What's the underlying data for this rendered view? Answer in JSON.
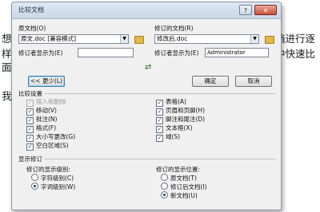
{
  "background_text": {
    "line1_left": "想要",
    "line1_right": "档进行逐",
    "line2_left": "样太",
    "line2_right": "中快速比",
    "line3_left": "面来",
    "line4_left": "我们"
  },
  "dialog": {
    "title": "比较文档",
    "help_button": "?",
    "close_button": "✕",
    "original_label": "原文档(O)",
    "original_value": "原文.doc [兼容模式]",
    "revised_label": "修订的文档(R)",
    "revised_value": "修改后.doc",
    "orig_author_label": "修订者显示为(E)",
    "orig_author_value": "",
    "rev_author_label": "修订者显示为(E)",
    "rev_author_value": "Administrator",
    "swap_icon": "⇄",
    "less_button": "<< 更少(L)",
    "ok_button": "确定",
    "cancel_button": "取消",
    "compare_settings_title": "比较设置",
    "settings_left": [
      {
        "label": "插入和删除",
        "checked": true,
        "disabled": true
      },
      {
        "label": "移动(V)",
        "checked": true,
        "disabled": false
      },
      {
        "label": "批注(N)",
        "checked": true,
        "disabled": false
      },
      {
        "label": "格式(F)",
        "checked": true,
        "disabled": false
      },
      {
        "label": "大小写更改(G)",
        "checked": true,
        "disabled": false
      },
      {
        "label": "空白区域(S)",
        "checked": true,
        "disabled": false
      }
    ],
    "settings_right": [
      {
        "label": "表格(A)",
        "checked": true
      },
      {
        "label": "页眉和页脚(H)",
        "checked": true
      },
      {
        "label": "脚注和尾注(D)",
        "checked": true
      },
      {
        "label": "文本框(X)",
        "checked": true
      },
      {
        "label": "域(S)",
        "checked": true
      }
    ],
    "show_changes_title": "显示修订",
    "level_title": "修订的显示级别:",
    "level_options": [
      {
        "label": "字符级别(C)",
        "selected": false
      },
      {
        "label": "字词级别(W)",
        "selected": true
      }
    ],
    "location_title": "修订的显示位置:",
    "location_options": [
      {
        "label": "原文档(T)",
        "selected": false
      },
      {
        "label": "修订后文档(I)",
        "selected": false
      },
      {
        "label": "新文档(U)",
        "selected": true
      }
    ],
    "checkmark": "✓"
  }
}
